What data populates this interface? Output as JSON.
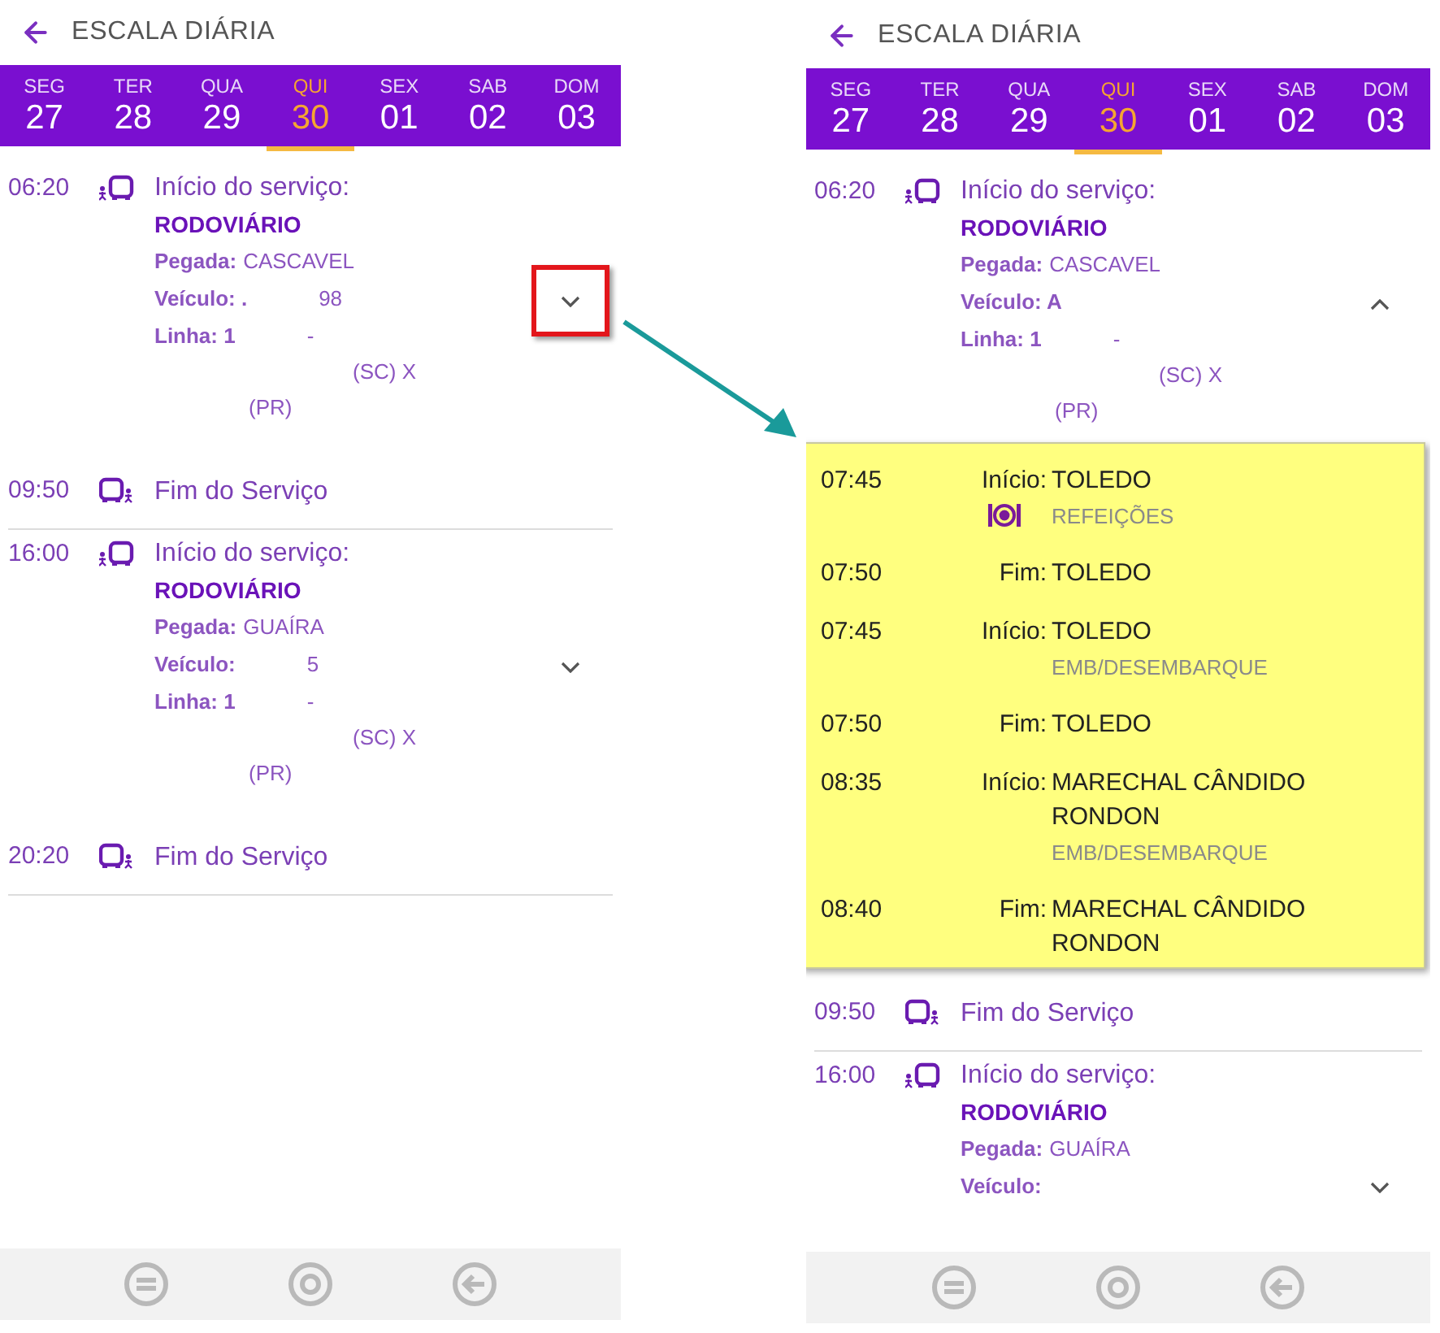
{
  "panels": [
    {
      "title": "ESCALA DIÁRIA",
      "days": [
        {
          "weekday": "SEG",
          "date": "27",
          "selected": false
        },
        {
          "weekday": "TER",
          "date": "28",
          "selected": false
        },
        {
          "weekday": "QUA",
          "date": "29",
          "selected": false
        },
        {
          "weekday": "QUI",
          "date": "30",
          "selected": true
        },
        {
          "weekday": "SEX",
          "date": "01",
          "selected": false
        },
        {
          "weekday": "SAB",
          "date": "02",
          "selected": false
        },
        {
          "weekday": "DOM",
          "date": "03",
          "selected": false
        }
      ],
      "entries": [
        {
          "kind": "start",
          "time": "06:20",
          "title": "Início do serviço:",
          "place": "RODOVIÁRIO",
          "expanded": false,
          "callout": true,
          "lines": [
            {
              "kind": "field",
              "label": "Pegada:",
              "parts": [
                "CASCAVEL"
              ],
              "spaced": false
            },
            {
              "kind": "field",
              "label": "Veículo: .",
              "parts": [
                "98"
              ],
              "spaced": true
            },
            {
              "kind": "field",
              "label": "Linha: 1",
              "parts": [
                "-"
              ],
              "spaced": true
            },
            {
              "kind": "wrap",
              "parts": [
                "(SC) X"
              ]
            },
            {
              "kind": "wrap",
              "parts": [
                "(PR)"
              ]
            }
          ]
        },
        {
          "kind": "end",
          "time": "09:50",
          "title": "Fim do Serviço"
        },
        {
          "kind": "start",
          "time": "16:00",
          "title": "Início do serviço:",
          "place": "RODOVIÁRIO",
          "expanded": false,
          "callout": false,
          "lines": [
            {
              "kind": "field",
              "label": "Pegada:",
              "parts": [
                "GUAÍRA"
              ],
              "spaced": false
            },
            {
              "kind": "field",
              "label": "Veículo:",
              "parts": [
                "5"
              ],
              "spaced": true
            },
            {
              "kind": "field",
              "label": "Linha: 1",
              "parts": [
                "-"
              ],
              "spaced": true
            },
            {
              "kind": "wrap",
              "parts": [
                "(SC) X"
              ]
            },
            {
              "kind": "wrap",
              "parts": [
                "(PR)"
              ]
            }
          ]
        },
        {
          "kind": "end",
          "time": "20:20",
          "title": "Fim do Serviço"
        }
      ]
    },
    {
      "title": "ESCALA DIÁRIA",
      "days": [
        {
          "weekday": "SEG",
          "date": "27",
          "selected": false
        },
        {
          "weekday": "TER",
          "date": "28",
          "selected": false
        },
        {
          "weekday": "QUA",
          "date": "29",
          "selected": false
        },
        {
          "weekday": "QUI",
          "date": "30",
          "selected": true
        },
        {
          "weekday": "SEX",
          "date": "01",
          "selected": false
        },
        {
          "weekday": "SAB",
          "date": "02",
          "selected": false
        },
        {
          "weekday": "DOM",
          "date": "03",
          "selected": false
        }
      ],
      "entries": [
        {
          "kind": "start",
          "time": "06:20",
          "title": "Início do serviço:",
          "place": "RODOVIÁRIO",
          "expanded": true,
          "callout": false,
          "lines": [
            {
              "kind": "field",
              "label": "Pegada:",
              "parts": [
                "CASCAVEL"
              ],
              "spaced": false
            },
            {
              "kind": "field",
              "label": "Veículo: A"
            },
            {
              "kind": "field",
              "label": "Linha: 1",
              "parts": [
                "-"
              ],
              "spaced": true
            },
            {
              "kind": "wrap",
              "parts": [
                "(SC) X"
              ]
            },
            {
              "kind": "wrap",
              "parts": [
                "(PR)"
              ]
            }
          ],
          "stops": [
            {
              "time": "07:45",
              "label": "Início:",
              "place": "TOLEDO",
              "sub": {
                "kind": "meal",
                "text": "REFEIÇÕES"
              }
            },
            {
              "time": "07:50",
              "label": "Fim:",
              "place": "TOLEDO"
            },
            {
              "time": "07:45",
              "label": "Início:",
              "place": "TOLEDO",
              "sub": {
                "kind": "plain",
                "text": "EMB/DESEMBARQUE"
              }
            },
            {
              "time": "07:50",
              "label": "Fim:",
              "place": "TOLEDO"
            },
            {
              "time": "08:35",
              "label": "Início:",
              "place": "MARECHAL CÂNDIDO RONDON",
              "sub": {
                "kind": "plain",
                "text": "EMB/DESEMBARQUE"
              }
            },
            {
              "time": "08:40",
              "label": "Fim:",
              "place": "MARECHAL CÂNDIDO RONDON"
            }
          ]
        },
        {
          "kind": "end",
          "time": "09:50",
          "title": "Fim do Serviço"
        },
        {
          "kind": "start",
          "time": "16:00",
          "title": "Início do serviço:",
          "place": "RODOVIÁRIO",
          "expanded": false,
          "callout": false,
          "lines": [
            {
              "kind": "field",
              "label": "Pegada:",
              "parts": [
                "GUAÍRA"
              ],
              "spaced": false
            },
            {
              "kind": "field",
              "label": "Veículo:"
            }
          ]
        }
      ]
    }
  ]
}
